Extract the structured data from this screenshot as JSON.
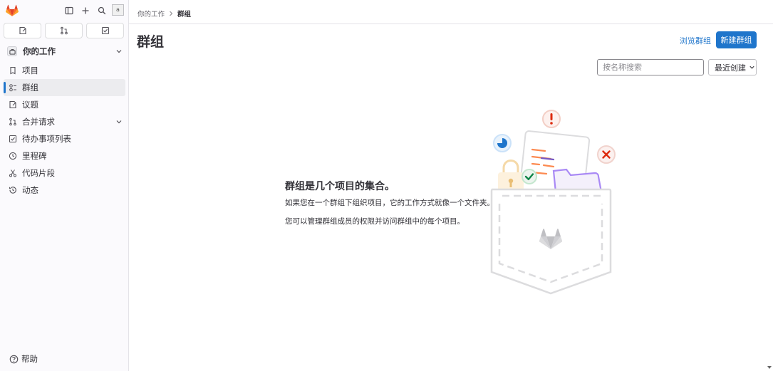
{
  "sidebar": {
    "context_label": "你的工作",
    "avatar_alt": "a",
    "items": [
      {
        "label": "项目",
        "icon": "project-icon"
      },
      {
        "label": "群组",
        "icon": "group-icon",
        "active": true
      },
      {
        "label": "议题",
        "icon": "issues-icon"
      },
      {
        "label": "合并请求",
        "icon": "merge-request-icon",
        "expandable": true
      },
      {
        "label": "待办事项列表",
        "icon": "todo-icon"
      },
      {
        "label": "里程碑",
        "icon": "milestone-icon"
      },
      {
        "label": "代码片段",
        "icon": "snippet-icon"
      },
      {
        "label": "动态",
        "icon": "activity-icon"
      }
    ],
    "help_label": "帮助"
  },
  "breadcrumb": {
    "parent": "你的工作",
    "current": "群组"
  },
  "main": {
    "title": "群组",
    "browse_label": "浏览群组",
    "new_label": "新建群组",
    "search_placeholder": "按名称搜索",
    "sort_label": "最近创建",
    "empty_title": "群组是几个项目的集合。",
    "empty_desc1": "如果您在一个群组下组织项目，它的工作方式就像一个文件夹。",
    "empty_desc2": "您可以管理群组成员的权限并访问群组中的每个项目。"
  },
  "colors": {
    "accent": "#1f75cb",
    "logo": "#e24329"
  }
}
